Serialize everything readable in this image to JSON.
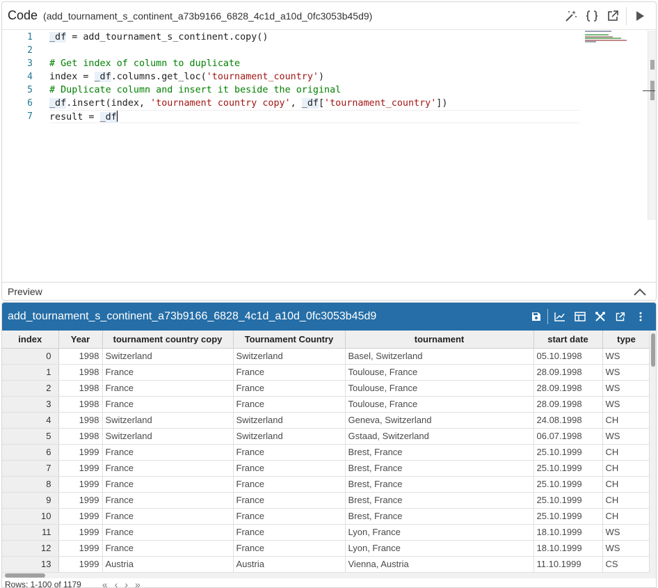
{
  "code_panel": {
    "title": "Code",
    "subtitle": "(add_tournament_s_continent_a73b9166_6828_4c1d_a10d_0fc3053b45d9)",
    "icons": [
      "magic-wand-icon",
      "braces-icon",
      "open-external-icon",
      "run-icon"
    ],
    "lines": [
      "1",
      "2",
      "3",
      "4",
      "5",
      "6",
      "7"
    ],
    "code": {
      "l1_a": "_df",
      "l1_b": " = add_tournament_s_continent.copy()",
      "l3": "# Get index of column to duplicate",
      "l4_a": "index = ",
      "l4_b": "_df",
      "l4_c": ".columns.get_loc(",
      "l4_d": "'tournament_country'",
      "l4_e": ")",
      "l5": "# Duplicate column and insert it beside the original",
      "l6_a": "_df",
      "l6_b": ".insert(index, ",
      "l6_c": "'tournament country copy'",
      "l6_d": ", ",
      "l6_e": "_df",
      "l6_f": "[",
      "l6_g": "'tournament_country'",
      "l6_h": "])",
      "l7_a": "result = ",
      "l7_b": "_df"
    },
    "preview_label": "Preview"
  },
  "data_panel": {
    "title": "add_tournament_s_continent_a73b9166_6828_4c1d_a10d_0fc3053b45d9",
    "icons": [
      "save-icon",
      "chart-icon",
      "table-view-icon",
      "tools-icon",
      "open-external-icon",
      "more-vert-icon"
    ],
    "columns": [
      "index",
      "Year",
      "tournament country copy",
      "Tournament Country",
      "tournament",
      "start date",
      "type"
    ],
    "rows": [
      [
        "0",
        "1998",
        "Switzerland",
        "Switzerland",
        "Basel, Switzerland",
        "05.10.1998",
        "WS"
      ],
      [
        "1",
        "1998",
        "France",
        "France",
        "Toulouse, France",
        "28.09.1998",
        "WS"
      ],
      [
        "2",
        "1998",
        "France",
        "France",
        "Toulouse, France",
        "28.09.1998",
        "WS"
      ],
      [
        "3",
        "1998",
        "France",
        "France",
        "Toulouse, France",
        "28.09.1998",
        "WS"
      ],
      [
        "4",
        "1998",
        "Switzerland",
        "Switzerland",
        "Geneva, Switzerland",
        "24.08.1998",
        "CH"
      ],
      [
        "5",
        "1998",
        "Switzerland",
        "Switzerland",
        "Gstaad, Switzerland",
        "06.07.1998",
        "WS"
      ],
      [
        "6",
        "1999",
        "France",
        "France",
        "Brest, France",
        "25.10.1999",
        "CH"
      ],
      [
        "7",
        "1999",
        "France",
        "France",
        "Brest, France",
        "25.10.1999",
        "CH"
      ],
      [
        "8",
        "1999",
        "France",
        "France",
        "Brest, France",
        "25.10.1999",
        "CH"
      ],
      [
        "9",
        "1999",
        "France",
        "France",
        "Brest, France",
        "25.10.1999",
        "CH"
      ],
      [
        "10",
        "1999",
        "France",
        "France",
        "Brest, France",
        "25.10.1999",
        "CH"
      ],
      [
        "11",
        "1999",
        "France",
        "France",
        "Lyon, France",
        "18.10.1999",
        "WS"
      ],
      [
        "12",
        "1999",
        "France",
        "France",
        "Lyon, France",
        "18.10.1999",
        "WS"
      ],
      [
        "13",
        "1999",
        "Austria",
        "Austria",
        "Vienna, Austria",
        "11.10.1999",
        "CS"
      ]
    ],
    "footer": {
      "rows_text": "Rows: 1-100 of 1179",
      "first": "«",
      "prev": "‹",
      "next": "›",
      "last": "»"
    }
  },
  "colors": {
    "header_blue": "#256ea7",
    "comment": "#008000",
    "string": "#a31515",
    "line_number": "#237893"
  }
}
